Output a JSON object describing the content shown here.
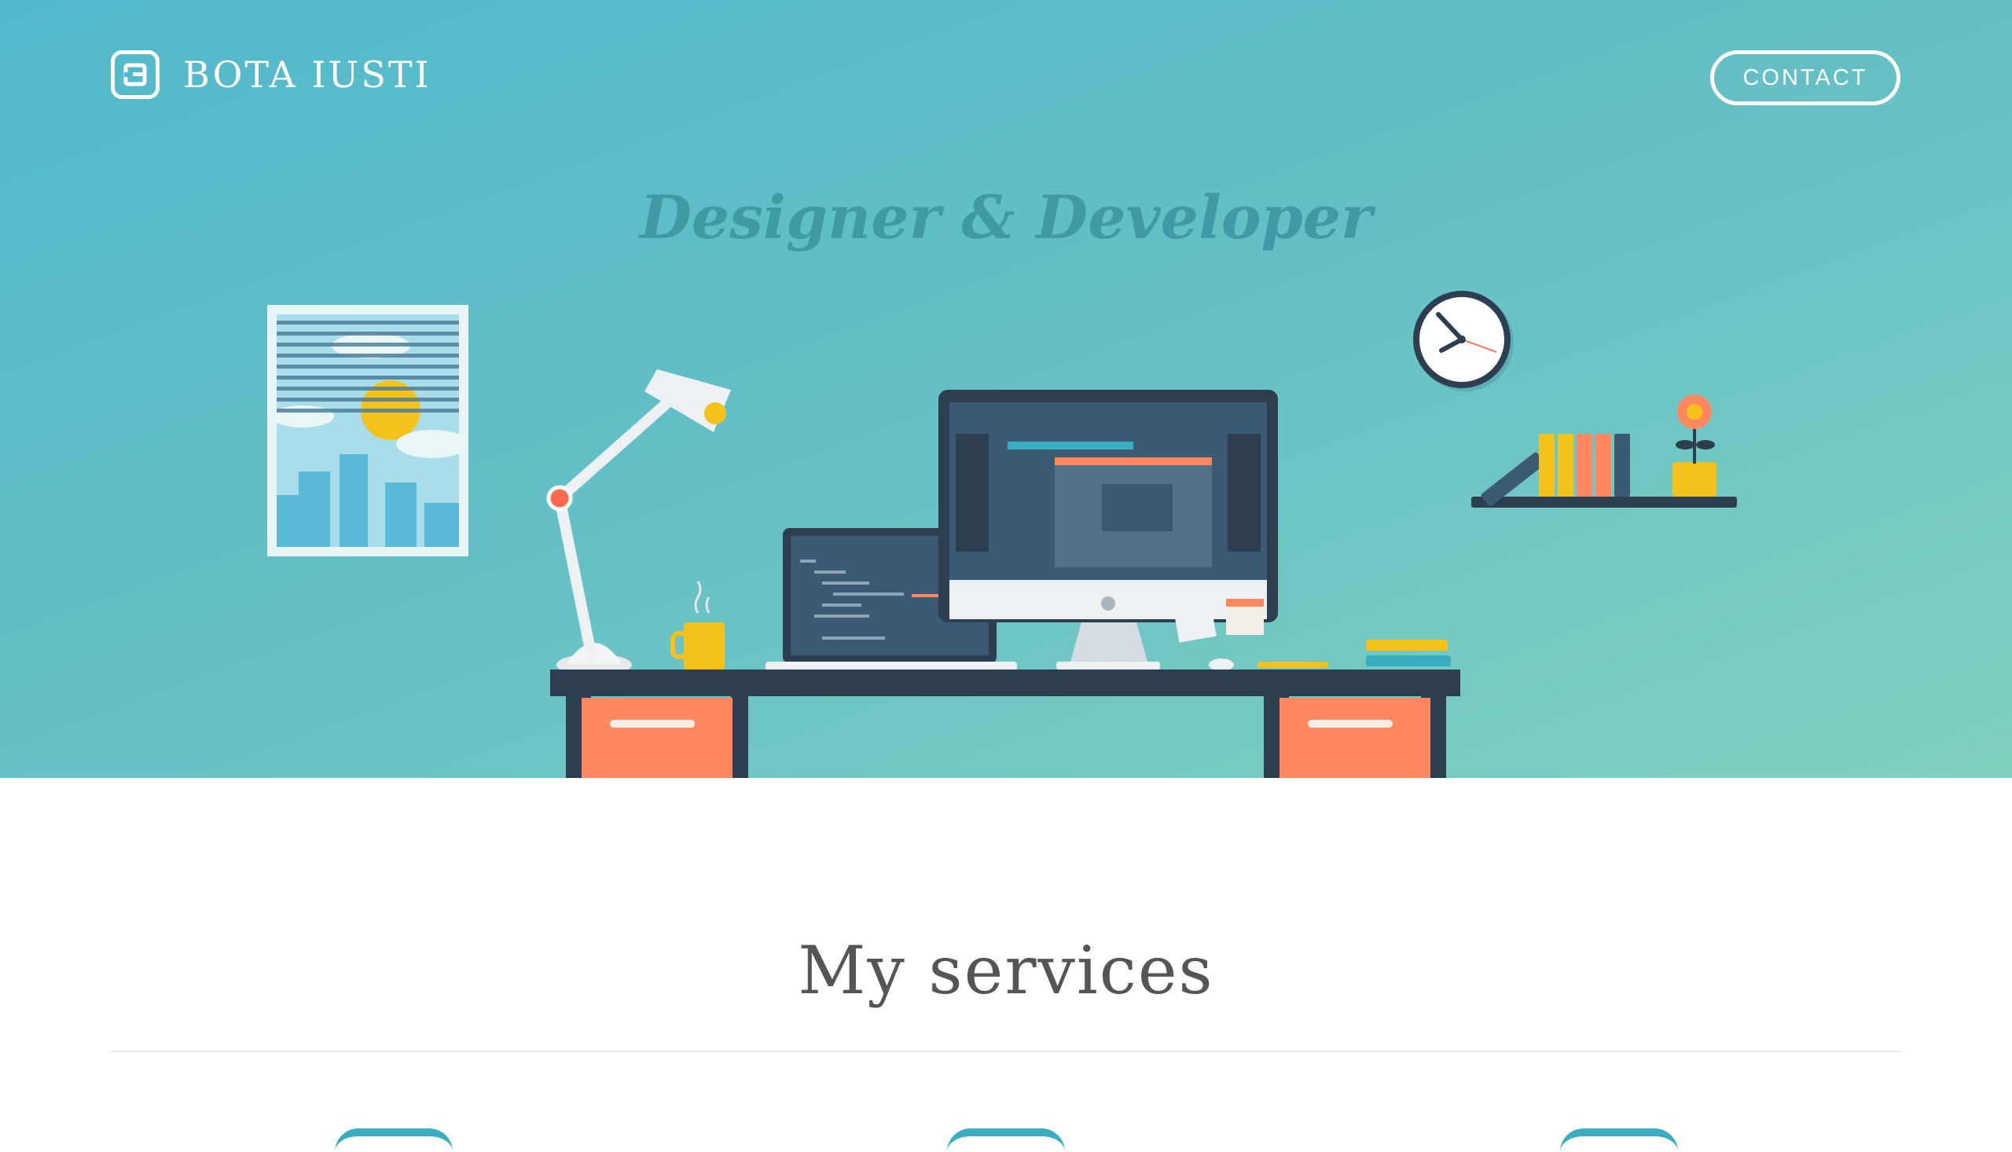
{
  "header": {
    "logo_icon": "b-logo-icon",
    "brand": "BOTA IUSTI",
    "contact_label": "CONTACT"
  },
  "hero": {
    "tagline": "Designer & Developer",
    "illustration": [
      "window-icon",
      "desk-lamp-icon",
      "coffee-mug-icon",
      "laptop-icon",
      "monitor-icon",
      "clock-icon",
      "shelf-binders-icon",
      "flower-pot-icon",
      "books-icon",
      "desk-icon"
    ]
  },
  "services": {
    "title": "My services"
  },
  "colors": {
    "hero_top": "#52b9cb",
    "hero_bottom": "#7fd0bf",
    "tagline": "#3f9aa6",
    "desk": "#2c3e50",
    "drawer": "#ff8860",
    "accent_yellow": "#f5c21b"
  }
}
